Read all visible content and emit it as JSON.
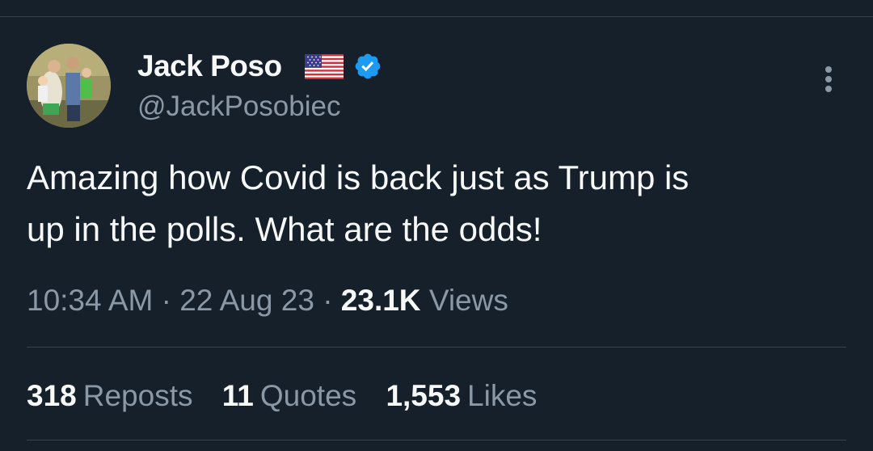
{
  "author": {
    "display_name": "Jack Poso",
    "handle": "@JackPosobiec",
    "badges": [
      "us-flag-emoji",
      "verified-badge-icon"
    ]
  },
  "tweet": {
    "text": "Amazing how Covid is back just as Trump is\nup in the polls. What are the odds!",
    "time": "10:34 AM",
    "separator": "·",
    "date": "22 Aug 23",
    "views_count": "23.1K",
    "views_label": "Views"
  },
  "stats": {
    "reposts_count": "318",
    "reposts_label": "Reposts",
    "quotes_count": "11",
    "quotes_label": "Quotes",
    "likes_count": "1,553",
    "likes_label": "Likes"
  },
  "colors": {
    "background": "#15202b",
    "primary_text": "#f7f9f9",
    "secondary_text": "#8b98a5",
    "verified": "#1d9bf0",
    "divider": "#38444d"
  }
}
